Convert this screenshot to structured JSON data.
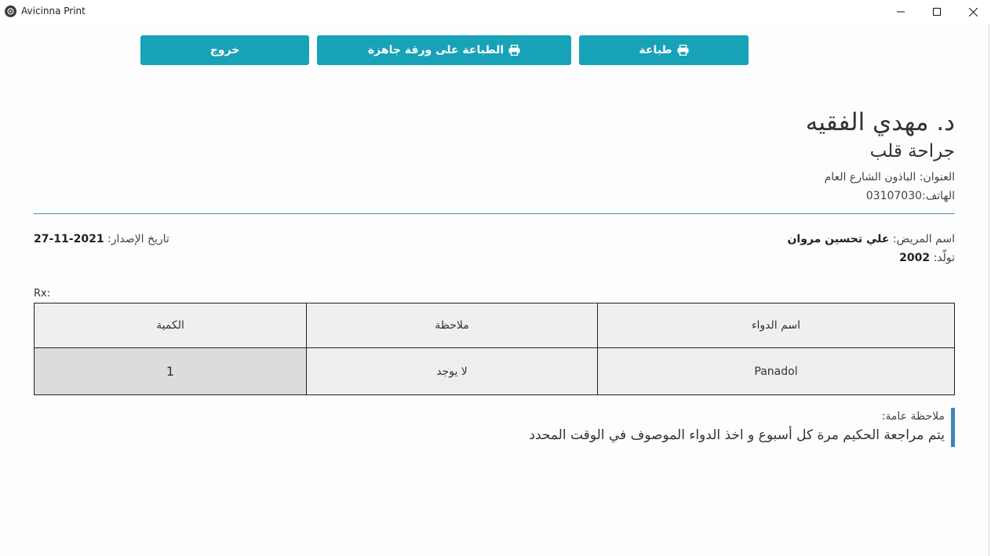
{
  "window": {
    "title": "Avicinna Print"
  },
  "toolbar": {
    "print_label": "طباعة",
    "print_ready_label": "الطباعة على ورقة جاهزة",
    "exit_label": "خروج"
  },
  "doctor": {
    "name": "د. مهدي الفقيه",
    "specialty": "جراحة قلب",
    "address_label": "العنوان:",
    "address_value": "الباذون الشارع العام",
    "phone_label": "الهاتف:",
    "phone_value": "03107030"
  },
  "patient": {
    "name_label": "اسم المريض:",
    "name_value": "علي تحسين مروان",
    "born_label": "تولّد:",
    "born_value": "2002"
  },
  "issue": {
    "label": "تاريخ الإصدار:",
    "value": "2021-11-27"
  },
  "rx_label": "Rx:",
  "table": {
    "headers": [
      "اسم الدواء",
      "ملاحظة",
      "الكمية"
    ],
    "rows": [
      [
        "Panadol",
        "لا يوجد",
        "1"
      ]
    ]
  },
  "general_note": {
    "label": "ملاحظة عامة:",
    "text": "يتم مراجعة الحكيم مرة كل أسبوع و اخذ الدواء الموصوف في الوقت المحدد"
  },
  "colors": {
    "accent": "#17a2b8",
    "divider": "#4a93ad",
    "note_bar": "#3d85b8"
  }
}
